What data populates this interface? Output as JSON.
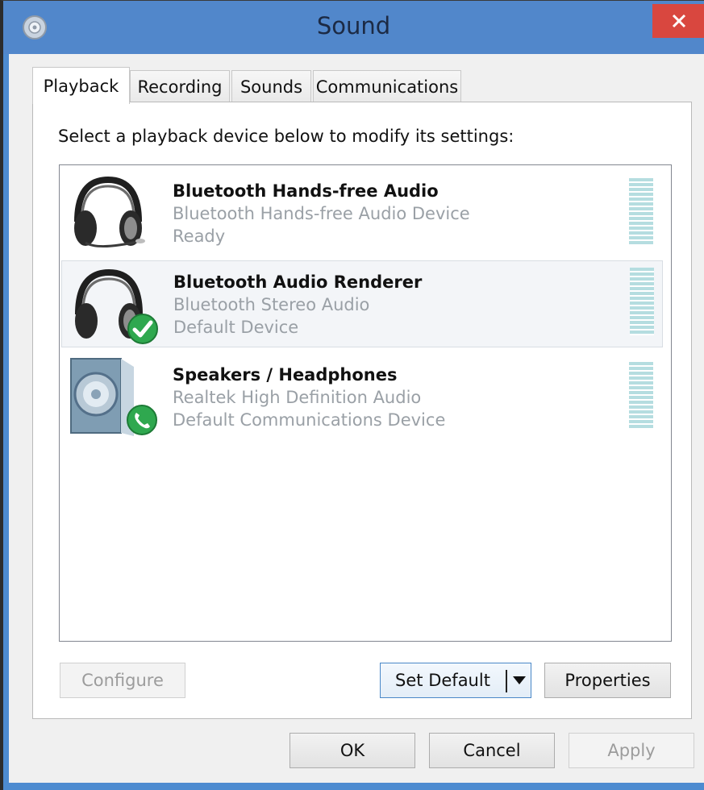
{
  "window": {
    "title": "Sound",
    "close_label": "✕"
  },
  "tabs": [
    {
      "label": "Playback",
      "active": true
    },
    {
      "label": "Recording",
      "active": false
    },
    {
      "label": "Sounds",
      "active": false
    },
    {
      "label": "Communications",
      "active": false
    }
  ],
  "playback": {
    "instruction": "Select a playback device below to modify its settings:",
    "devices": [
      {
        "name": "Bluetooth Hands-free Audio",
        "description": "Bluetooth Hands-free Audio Device",
        "status": "Ready",
        "icon": "headset-icon",
        "badge": "none",
        "selected": false
      },
      {
        "name": "Bluetooth Audio Renderer",
        "description": "Bluetooth Stereo Audio",
        "status": "Default Device",
        "icon": "headphones-icon",
        "badge": "default-checkmark-icon",
        "selected": true
      },
      {
        "name": "Speakers / Headphones",
        "description": "Realtek High Definition Audio",
        "status": "Default Communications Device",
        "icon": "speaker-icon",
        "badge": "communications-phone-icon",
        "selected": false
      }
    ],
    "buttons": {
      "configure": "Configure",
      "set_default": "Set Default",
      "properties": "Properties"
    }
  },
  "footer": {
    "ok": "OK",
    "cancel": "Cancel",
    "apply": "Apply"
  },
  "colors": {
    "title_bar": "#5187cb",
    "close_button": "#d9473f",
    "level_meter": "#b5dde0",
    "default_badge": "#2fa84f"
  }
}
